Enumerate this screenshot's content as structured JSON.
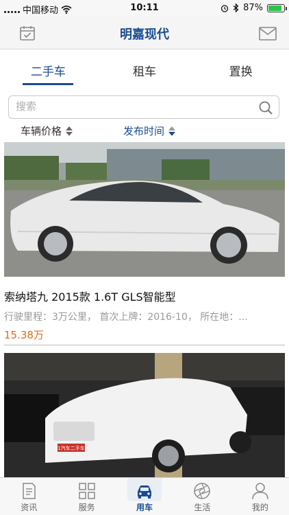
{
  "status_bar": {
    "carrier": "中国移动",
    "time": "10:11",
    "battery": "87%",
    "battery_level": 0.87
  },
  "nav": {
    "title": "明嘉现代",
    "left_icon": "calendar-check-icon",
    "right_icon": "mail-icon"
  },
  "tabs": [
    {
      "label": "二手车",
      "active": true
    },
    {
      "label": "租车",
      "active": false
    },
    {
      "label": "置换",
      "active": false
    }
  ],
  "search": {
    "placeholder": "搜索",
    "value": ""
  },
  "sort": {
    "price_label": "车辆价格",
    "time_label": "发布时间"
  },
  "listings": [
    {
      "title": "索纳塔九 2015款 1.6T GLS智能型",
      "meta": "行驶里程：3万公里， 首次上牌：2016-10， 所在地：...",
      "price": "15.38万"
    },
    {
      "plate": "1汽车二手车"
    }
  ],
  "tab_bar": [
    {
      "label": "资讯",
      "icon": "document-icon"
    },
    {
      "label": "服务",
      "icon": "grid-icon"
    },
    {
      "label": "用车",
      "icon": "car-icon",
      "active": true
    },
    {
      "label": "生活",
      "icon": "aperture-icon"
    },
    {
      "label": "我的",
      "icon": "user-icon"
    }
  ],
  "colors": {
    "accent": "#1a4c92",
    "price": "#e26a1b",
    "battery": "#2ec24b"
  }
}
